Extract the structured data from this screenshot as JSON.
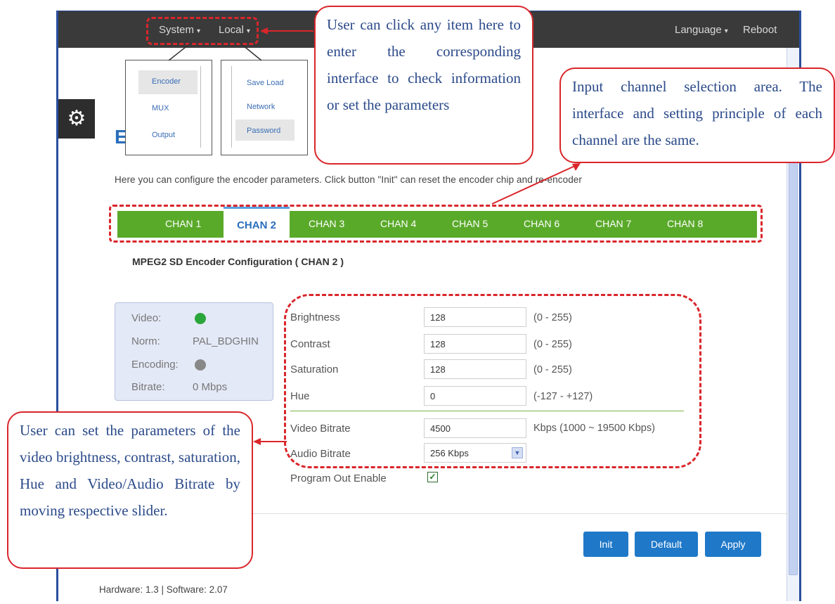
{
  "navbar": {
    "system_label": "System",
    "local_label": "Local",
    "language_label": "Language",
    "reboot_label": "Reboot"
  },
  "system_menu": {
    "items": [
      "Encoder",
      "MUX",
      "Output"
    ]
  },
  "local_menu": {
    "items": [
      "Save Load",
      "Network",
      "Password"
    ]
  },
  "page": {
    "title_letter": "E",
    "description": "Here you can configure the encoder parameters. Click button \"Init\" can reset the encoder chip and re-encoder",
    "config_title": "MPEG2 SD Encoder Configuration ( CHAN 2 )"
  },
  "tabs": [
    {
      "label": "CHAN 1",
      "active": false
    },
    {
      "label": "CHAN 2",
      "active": true
    },
    {
      "label": "CHAN 3",
      "active": false
    },
    {
      "label": "CHAN 4",
      "active": false
    },
    {
      "label": "CHAN 5",
      "active": false
    },
    {
      "label": "CHAN 6",
      "active": false
    },
    {
      "label": "CHAN 7",
      "active": false
    },
    {
      "label": "CHAN 8",
      "active": false
    }
  ],
  "status": {
    "video_label": "Video:",
    "norm_label": "Norm:",
    "norm_value": "PAL_BDGHIN",
    "encoding_label": "Encoding:",
    "bitrate_label": "Bitrate:",
    "bitrate_value": "0 Mbps",
    "video_color": "#2aa63a",
    "encoding_color": "#888888"
  },
  "params": {
    "brightness": {
      "label": "Brightness",
      "value": "128",
      "range": "(0 - 255)"
    },
    "contrast": {
      "label": "Contrast",
      "value": "128",
      "range": "(0 - 255)"
    },
    "saturation": {
      "label": "Saturation",
      "value": "128",
      "range": "(0 - 255)"
    },
    "hue": {
      "label": "Hue",
      "value": "0",
      "range": "(-127 - +127)"
    },
    "video_bitrate": {
      "label": "Video Bitrate",
      "value": "4500",
      "range": "Kbps (1000 ~ 19500 Kbps)"
    },
    "audio_bitrate": {
      "label": "Audio Bitrate",
      "value": "256 Kbps"
    },
    "program_out": {
      "label": "Program Out Enable",
      "checked": true
    }
  },
  "buttons": {
    "init": "Init",
    "default": "Default",
    "apply": "Apply"
  },
  "footer": {
    "text": "Hardware: 1.3 | Software: 2.07"
  },
  "callouts": {
    "menu": "User can click any item here to enter the corresponding interface to check information or set the parameters",
    "channel": "Input channel selection area. The interface and setting principle of each channel are the same.",
    "params": "User can set the parameters of the video brightness, contrast, saturation, Hue and Video/Audio Bitrate by moving respective slider."
  },
  "colors": {
    "accent": "#d9262b",
    "tab_bar": "#5aaa2a",
    "button": "#1f78c8",
    "callout_text": "#2b4a8a"
  }
}
